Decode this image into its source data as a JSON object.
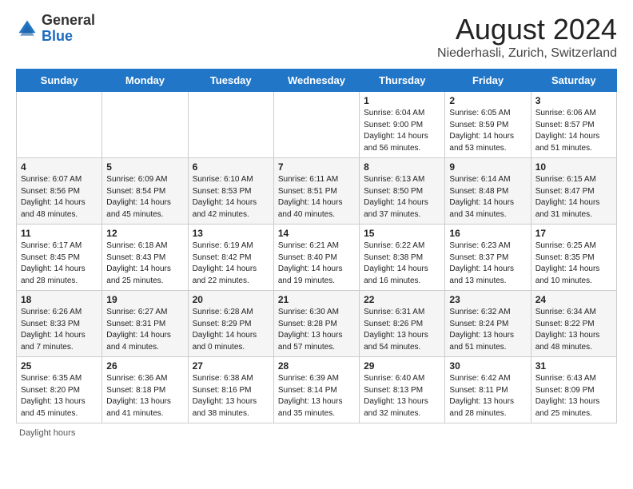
{
  "header": {
    "logo_general": "General",
    "logo_blue": "Blue",
    "main_title": "August 2024",
    "subtitle": "Niederhasli, Zurich, Switzerland"
  },
  "footer": {
    "label": "Daylight hours"
  },
  "days_of_week": [
    "Sunday",
    "Monday",
    "Tuesday",
    "Wednesday",
    "Thursday",
    "Friday",
    "Saturday"
  ],
  "weeks": [
    [
      {
        "day": "",
        "info": ""
      },
      {
        "day": "",
        "info": ""
      },
      {
        "day": "",
        "info": ""
      },
      {
        "day": "",
        "info": ""
      },
      {
        "day": "1",
        "info": "Sunrise: 6:04 AM\nSunset: 9:00 PM\nDaylight: 14 hours\nand 56 minutes."
      },
      {
        "day": "2",
        "info": "Sunrise: 6:05 AM\nSunset: 8:59 PM\nDaylight: 14 hours\nand 53 minutes."
      },
      {
        "day": "3",
        "info": "Sunrise: 6:06 AM\nSunset: 8:57 PM\nDaylight: 14 hours\nand 51 minutes."
      }
    ],
    [
      {
        "day": "4",
        "info": "Sunrise: 6:07 AM\nSunset: 8:56 PM\nDaylight: 14 hours\nand 48 minutes."
      },
      {
        "day": "5",
        "info": "Sunrise: 6:09 AM\nSunset: 8:54 PM\nDaylight: 14 hours\nand 45 minutes."
      },
      {
        "day": "6",
        "info": "Sunrise: 6:10 AM\nSunset: 8:53 PM\nDaylight: 14 hours\nand 42 minutes."
      },
      {
        "day": "7",
        "info": "Sunrise: 6:11 AM\nSunset: 8:51 PM\nDaylight: 14 hours\nand 40 minutes."
      },
      {
        "day": "8",
        "info": "Sunrise: 6:13 AM\nSunset: 8:50 PM\nDaylight: 14 hours\nand 37 minutes."
      },
      {
        "day": "9",
        "info": "Sunrise: 6:14 AM\nSunset: 8:48 PM\nDaylight: 14 hours\nand 34 minutes."
      },
      {
        "day": "10",
        "info": "Sunrise: 6:15 AM\nSunset: 8:47 PM\nDaylight: 14 hours\nand 31 minutes."
      }
    ],
    [
      {
        "day": "11",
        "info": "Sunrise: 6:17 AM\nSunset: 8:45 PM\nDaylight: 14 hours\nand 28 minutes."
      },
      {
        "day": "12",
        "info": "Sunrise: 6:18 AM\nSunset: 8:43 PM\nDaylight: 14 hours\nand 25 minutes."
      },
      {
        "day": "13",
        "info": "Sunrise: 6:19 AM\nSunset: 8:42 PM\nDaylight: 14 hours\nand 22 minutes."
      },
      {
        "day": "14",
        "info": "Sunrise: 6:21 AM\nSunset: 8:40 PM\nDaylight: 14 hours\nand 19 minutes."
      },
      {
        "day": "15",
        "info": "Sunrise: 6:22 AM\nSunset: 8:38 PM\nDaylight: 14 hours\nand 16 minutes."
      },
      {
        "day": "16",
        "info": "Sunrise: 6:23 AM\nSunset: 8:37 PM\nDaylight: 14 hours\nand 13 minutes."
      },
      {
        "day": "17",
        "info": "Sunrise: 6:25 AM\nSunset: 8:35 PM\nDaylight: 14 hours\nand 10 minutes."
      }
    ],
    [
      {
        "day": "18",
        "info": "Sunrise: 6:26 AM\nSunset: 8:33 PM\nDaylight: 14 hours\nand 7 minutes."
      },
      {
        "day": "19",
        "info": "Sunrise: 6:27 AM\nSunset: 8:31 PM\nDaylight: 14 hours\nand 4 minutes."
      },
      {
        "day": "20",
        "info": "Sunrise: 6:28 AM\nSunset: 8:29 PM\nDaylight: 14 hours\nand 0 minutes."
      },
      {
        "day": "21",
        "info": "Sunrise: 6:30 AM\nSunset: 8:28 PM\nDaylight: 13 hours\nand 57 minutes."
      },
      {
        "day": "22",
        "info": "Sunrise: 6:31 AM\nSunset: 8:26 PM\nDaylight: 13 hours\nand 54 minutes."
      },
      {
        "day": "23",
        "info": "Sunrise: 6:32 AM\nSunset: 8:24 PM\nDaylight: 13 hours\nand 51 minutes."
      },
      {
        "day": "24",
        "info": "Sunrise: 6:34 AM\nSunset: 8:22 PM\nDaylight: 13 hours\nand 48 minutes."
      }
    ],
    [
      {
        "day": "25",
        "info": "Sunrise: 6:35 AM\nSunset: 8:20 PM\nDaylight: 13 hours\nand 45 minutes."
      },
      {
        "day": "26",
        "info": "Sunrise: 6:36 AM\nSunset: 8:18 PM\nDaylight: 13 hours\nand 41 minutes."
      },
      {
        "day": "27",
        "info": "Sunrise: 6:38 AM\nSunset: 8:16 PM\nDaylight: 13 hours\nand 38 minutes."
      },
      {
        "day": "28",
        "info": "Sunrise: 6:39 AM\nSunset: 8:14 PM\nDaylight: 13 hours\nand 35 minutes."
      },
      {
        "day": "29",
        "info": "Sunrise: 6:40 AM\nSunset: 8:13 PM\nDaylight: 13 hours\nand 32 minutes."
      },
      {
        "day": "30",
        "info": "Sunrise: 6:42 AM\nSunset: 8:11 PM\nDaylight: 13 hours\nand 28 minutes."
      },
      {
        "day": "31",
        "info": "Sunrise: 6:43 AM\nSunset: 8:09 PM\nDaylight: 13 hours\nand 25 minutes."
      }
    ]
  ]
}
